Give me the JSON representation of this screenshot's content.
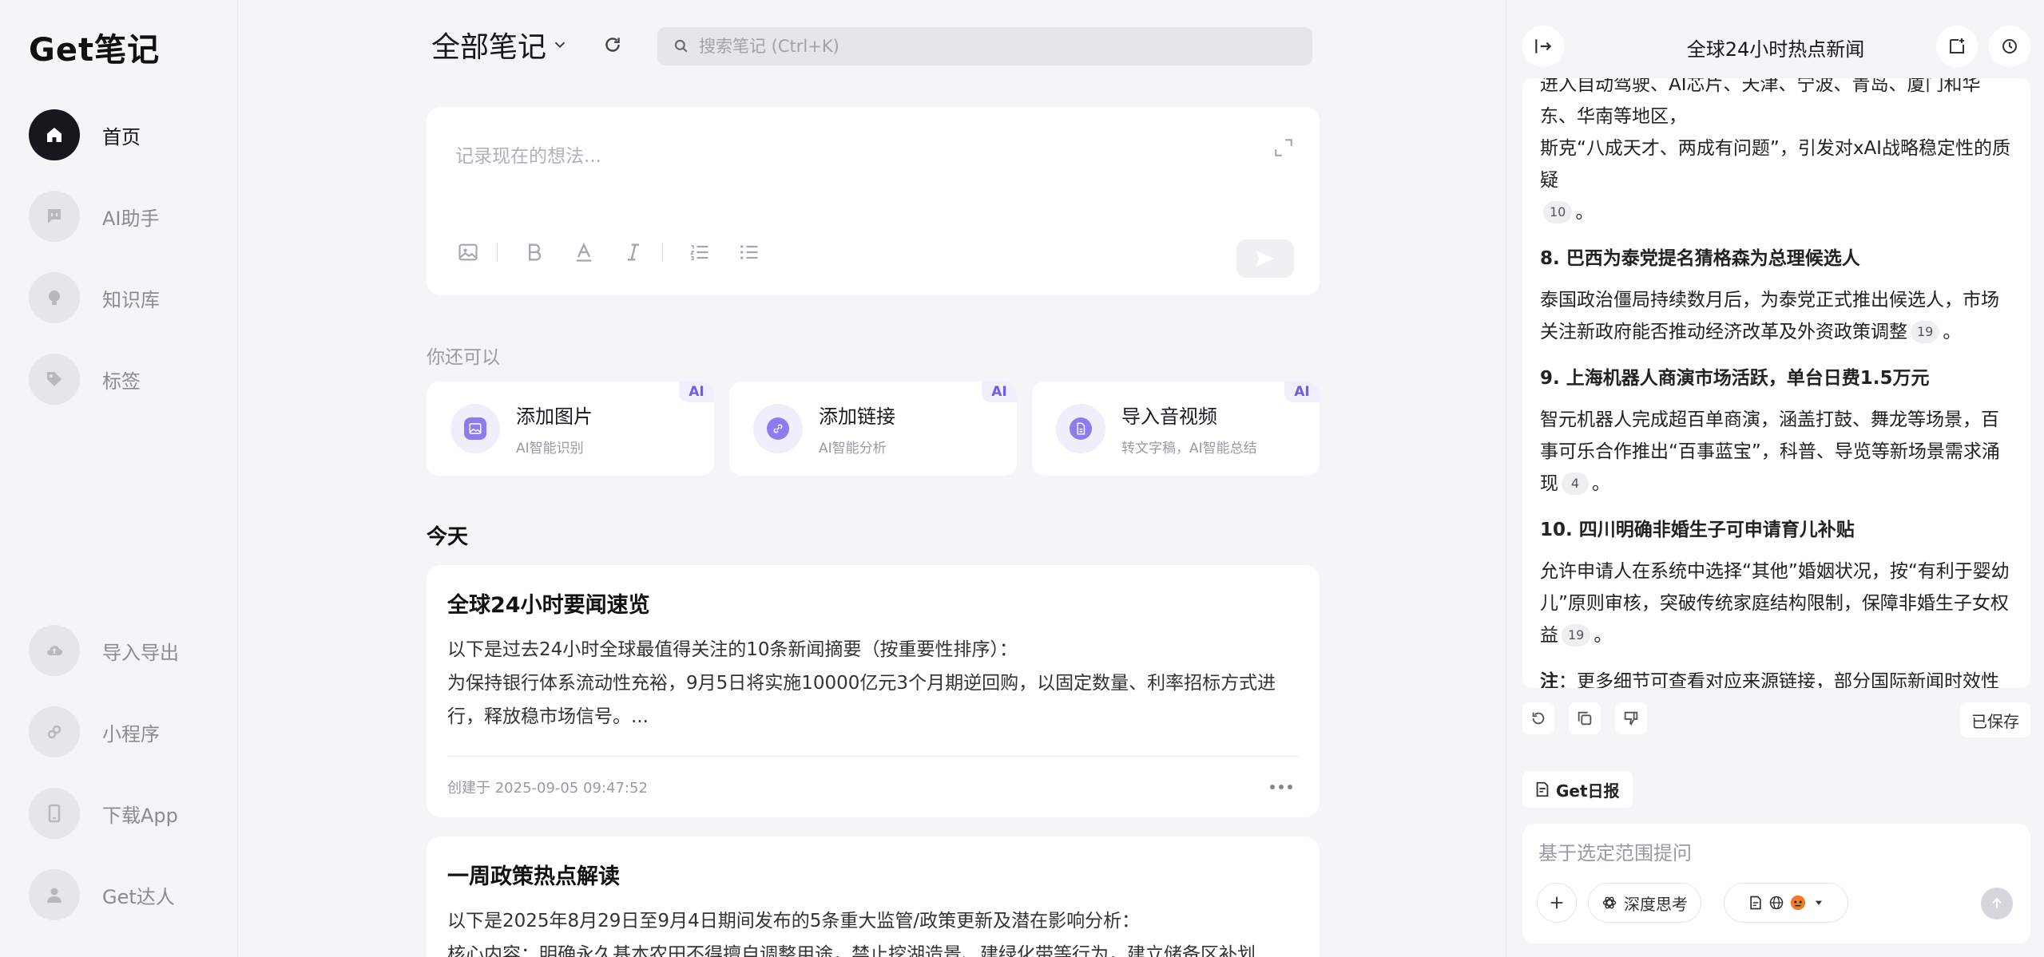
{
  "app": {
    "logo": "Get笔记"
  },
  "sidebar": {
    "items": [
      {
        "label": "首页",
        "icon": "home-icon",
        "active": true
      },
      {
        "label": "AI助手",
        "icon": "chat-icon"
      },
      {
        "label": "知识库",
        "icon": "bulb-icon"
      },
      {
        "label": "标签",
        "icon": "tag-icon"
      }
    ],
    "bottom_items": [
      {
        "label": "导入导出",
        "icon": "cloud-upload-icon"
      },
      {
        "label": "小程序",
        "icon": "mini-program-icon"
      },
      {
        "label": "下载App",
        "icon": "phone-icon"
      },
      {
        "label": "Get达人",
        "icon": "person-icon"
      }
    ]
  },
  "main": {
    "title": "全部笔记",
    "search_placeholder": "搜索笔记 (Ctrl+K)",
    "editor_placeholder": "记录现在的想法...",
    "also_label": "你还可以",
    "quick_actions": [
      {
        "title": "添加图片",
        "subtitle": "AI智能识别",
        "badge": "AI",
        "icon": "image-icon"
      },
      {
        "title": "添加链接",
        "subtitle": "AI智能分析",
        "badge": "AI",
        "icon": "link-icon"
      },
      {
        "title": "导入音视频",
        "subtitle": "转文字稿，AI智能总结",
        "badge": "AI",
        "icon": "audio-file-icon"
      }
    ],
    "section_today": "今天",
    "notes": [
      {
        "title": "全球24小时要闻速览",
        "line1": "以下是过去24小时全球最值得关注的10条新闻摘要（按重要性排序）：",
        "line2": "为保持银行体系流动性充裕，9月5日将实施10000亿元3个月期逆回购，以固定数量、利率招标方式进行，释放稳市场信号。...",
        "meta": "创建于 2025-09-05 09:47:52"
      },
      {
        "title": "一周政策热点解读",
        "line1": "以下是2025年8月29日至9月4日期间发布的5条重大监管/政策更新及潜在影响分析：",
        "line2": "核心内容：明确永久基本农田不得擅自调整用途，禁止挖湖造景、建绿化带等行为，建立储备区补划"
      }
    ]
  },
  "right_panel": {
    "title": "全球24小时热点新闻",
    "top_fragment_1": "进入自动驾驶、AI芯片、天津、宁波、青岛、厦门和华东、华南等地区，",
    "top_fragment_2": "斯克“八成天才、两成有问题”，引发对xAI战略稳定性的质疑",
    "top_cite": "10",
    "items": [
      {
        "head": "8. 巴西为泰党提名猜格森为总理候选人",
        "body": "泰国政治僵局持续数月后，为泰党正式推出候选人，市场关注新政府能否推动经济改革及外资政策调整",
        "cite": "19"
      },
      {
        "head": "9. 上海机器人商演市场活跃，单台日费1.5万元",
        "body": "智元机器人完成超百单商演，涵盖打鼓、舞龙等场景，百事可乐合作推出“百事蓝宝”，科普、导览等新场景需求涌现",
        "cite": "4"
      },
      {
        "head": "10. 四川明确非婚生子可申请育儿补贴",
        "body": "允许申请人在系统中选择“其他”婚姻状况，按“有利于婴幼儿”原则审核，突破传统家庭结构限制，保障非婚生子女权益",
        "cite": "19"
      }
    ],
    "note_label": "注",
    "note_text": "：更多细节可查看对应来源链接，部分国际新闻时效性较强，建议结合实时动态跟踪。",
    "period": "。",
    "saved_label": "已保存",
    "daily_label": "Get日报",
    "composer_placeholder": "基于选定范围提问",
    "deep_think_label": "深度思考"
  }
}
